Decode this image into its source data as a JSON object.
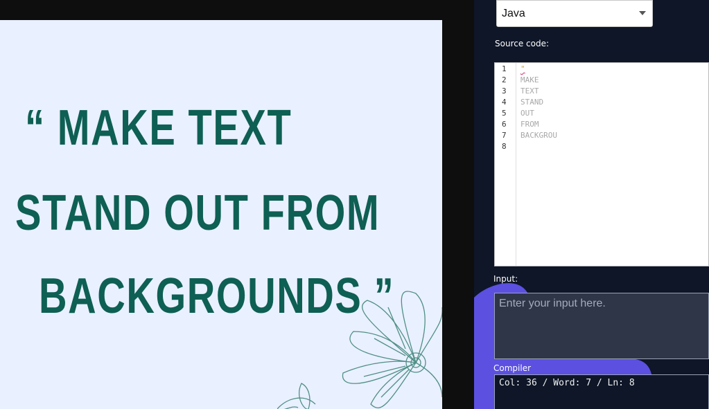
{
  "image": {
    "line1": "“ MAKE TEXT",
    "line2": "STAND OUT FROM",
    "line3": "BACKGROUNDS ”",
    "text_color": "#0e5f54",
    "background_color": "#e9f0ff"
  },
  "editor": {
    "language": "Java",
    "source_label": "Source code:",
    "lines": [
      {
        "num": "1",
        "text": "\""
      },
      {
        "num": "2",
        "text": "MAKE"
      },
      {
        "num": "3",
        "text": "TEXT"
      },
      {
        "num": "4",
        "text": "STAND"
      },
      {
        "num": "5",
        "text": "OUT"
      },
      {
        "num": "6",
        "text": "FROM"
      },
      {
        "num": "7",
        "text": "BACKGROU"
      },
      {
        "num": "8",
        "text": ""
      }
    ],
    "input_label": "Input:",
    "input_placeholder": "Enter your input here.",
    "compiler_label": "Compiler",
    "compiler_output": "Col: 36 / Word: 7 / Ln: 8",
    "accent_color": "#5b50e0",
    "panel_color": "#0e1628"
  }
}
